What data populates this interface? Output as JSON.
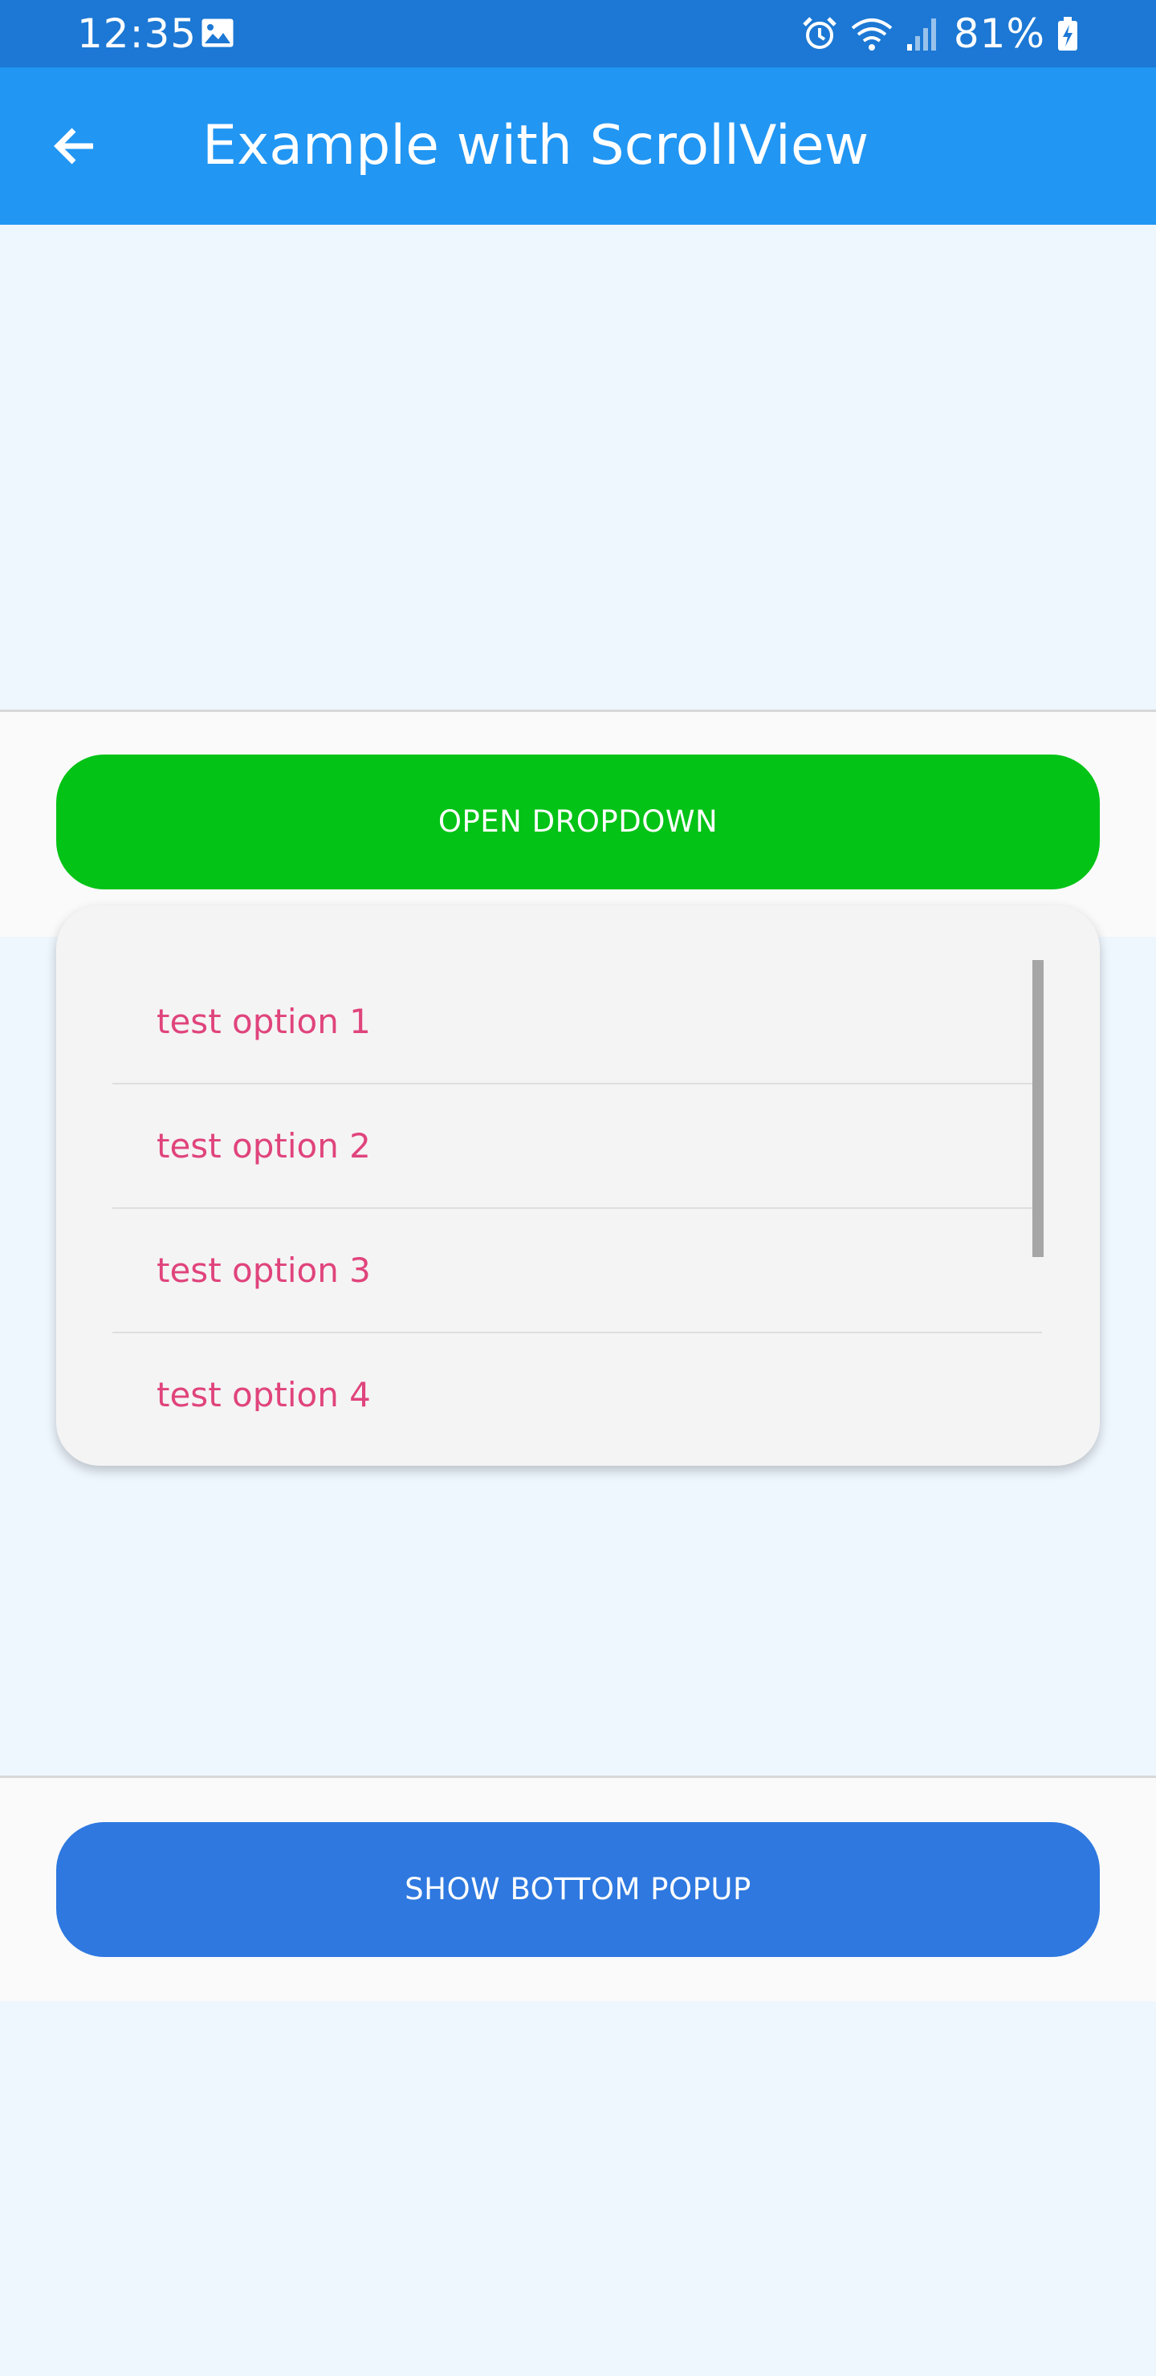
{
  "status_bar": {
    "time": "12:35",
    "battery": "81%",
    "icons": [
      "image-icon",
      "alarm-icon",
      "wifi-icon",
      "signal-icon",
      "battery-charging-icon"
    ]
  },
  "app_bar": {
    "title": "Example with ScrollView",
    "back_icon": "arrow-left-icon"
  },
  "dropdown_section": {
    "button_label": "OPEN DROPDOWN",
    "options": [
      "test option 1",
      "test option 2",
      "test option 3",
      "test option 4"
    ]
  },
  "bottom_section": {
    "button_label": "SHOW BOTTOM POPUP"
  },
  "colors": {
    "status_bar": "#1c78d4",
    "app_bar": "#2196f3",
    "page_background": "#eef6fe",
    "section_background": "#fafafa",
    "dropdown_button": "#03c316",
    "popup_button": "#2e78e0",
    "option_text": "#e0447c",
    "dropdown_background": "#f4f4f4"
  }
}
